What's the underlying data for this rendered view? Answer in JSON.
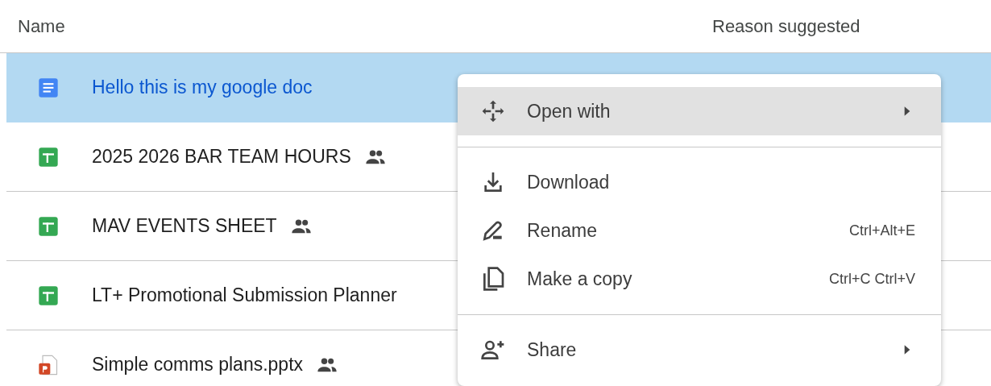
{
  "columns": [
    "Name",
    "Reason suggested"
  ],
  "files": [
    {
      "name": "Hello this is my google doc",
      "kind": "doc",
      "shared": false,
      "selected": true
    },
    {
      "name": "2025 2026 BAR TEAM HOURS",
      "kind": "sheet",
      "shared": true,
      "selected": false
    },
    {
      "name": "MAV EVENTS SHEET",
      "kind": "sheet",
      "shared": true,
      "selected": false
    },
    {
      "name": "LT+ Promotional Submission Planner",
      "kind": "sheet",
      "shared": false,
      "selected": false
    },
    {
      "name": "Simple comms plans.pptx",
      "kind": "slides",
      "shared": true,
      "selected": false
    }
  ],
  "context_menu": {
    "items": [
      {
        "kind": "entry",
        "label": "Open with",
        "submenu": true,
        "highlighted": true
      },
      {
        "kind": "divider"
      },
      {
        "kind": "entry",
        "label": "Download",
        "submenu": false,
        "highlighted": false
      },
      {
        "kind": "entry",
        "label": "Rename",
        "shortcut": "Ctrl+Alt+E",
        "submenu": false,
        "highlighted": false
      },
      {
        "kind": "entry",
        "label": "Make a copy",
        "shortcut": "Ctrl+C Ctrl+V",
        "submenu": false,
        "highlighted": false
      },
      {
        "kind": "divider"
      },
      {
        "kind": "entry",
        "label": "Share",
        "submenu": true,
        "highlighted": false
      }
    ]
  }
}
